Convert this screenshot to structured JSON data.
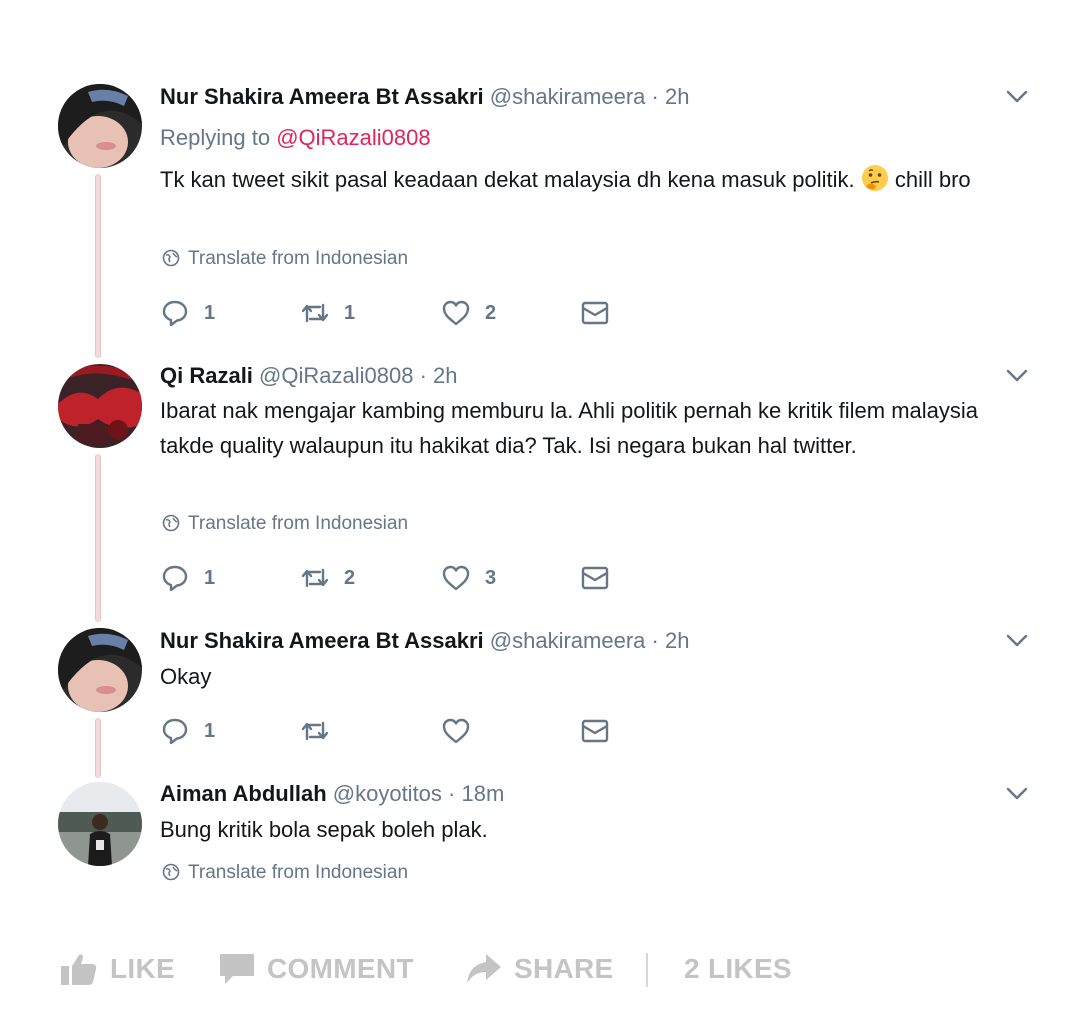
{
  "tweets": [
    {
      "name": "Nur Shakira Ameera Bt Assakri",
      "handle": "@shakirameera",
      "dot": "·",
      "time": "2h",
      "replying_prefix": "Replying to ",
      "replying_to": "@QiRazali0808",
      "text_before_emoji": "Tk kan tweet sikit pasal keadaan dekat malaysia dh kena masuk politik.",
      "emoji": "thinking-face-emoji",
      "text_after_emoji": " chill bro",
      "translate": "Translate from Indonesian",
      "replies": "1",
      "retweets": "1",
      "likes": "2"
    },
    {
      "name": "Qi Razali",
      "handle": "@QiRazali0808",
      "dot": "·",
      "time": "2h",
      "text": "Ibarat nak mengajar kambing memburu la. Ahli politik pernah ke kritik filem malaysia takde quality walaupun itu hakikat dia? Tak. Isi negara bukan hal twitter.",
      "translate": "Translate from Indonesian",
      "replies": "1",
      "retweets": "2",
      "likes": "3"
    },
    {
      "name": "Nur Shakira Ameera Bt Assakri",
      "handle": "@shakirameera",
      "dot": "·",
      "time": "2h",
      "text": "Okay",
      "replies": "1",
      "retweets": "",
      "likes": ""
    },
    {
      "name": "Aiman Abdullah",
      "handle": "@koyotitos",
      "dot": "·",
      "time": "18m",
      "text": "Bung kritik bola sepak boleh plak.",
      "translate": "Translate from Indonesian"
    }
  ],
  "bottom_bar": {
    "like": "LIKE",
    "comment": "COMMENT",
    "share": "SHARE",
    "likes_count": "2 LIKES"
  },
  "colors": {
    "secondary_text": "#657786",
    "mention": "#e0245e",
    "bottom_bar_text": "#c4c4c4"
  }
}
